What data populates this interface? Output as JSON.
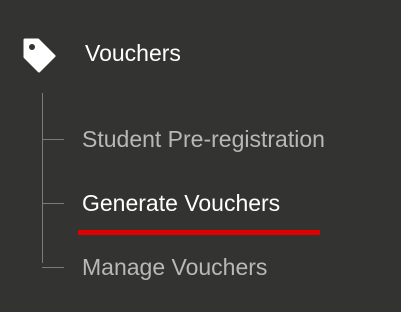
{
  "menu": {
    "header": {
      "icon": "tag-icon",
      "label": "Vouchers"
    },
    "items": [
      {
        "label": "Student Pre-registration",
        "active": false
      },
      {
        "label": "Generate Vouchers",
        "active": true
      },
      {
        "label": "Manage Vouchers",
        "active": false
      }
    ]
  },
  "colors": {
    "panel_background": "#333331",
    "active_text": "#ffffff",
    "inactive_text": "#b8b8b4",
    "tree_line": "#7b7b77",
    "active_indicator": "#e00000"
  }
}
